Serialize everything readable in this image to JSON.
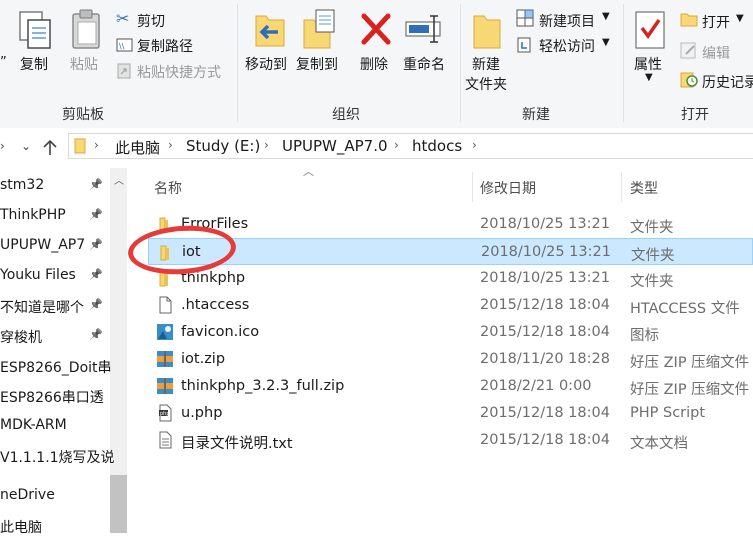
{
  "ribbon": {
    "clipboard": {
      "copy_stub": "”",
      "copy": "复制",
      "paste": "粘贴",
      "cut": "剪切",
      "copy_path": "复制路径",
      "paste_shortcut": "粘贴快捷方式",
      "group": "剪贴板"
    },
    "organize": {
      "move_to": "移动到",
      "copy_to": "复制到",
      "delete": "删除",
      "rename": "重命名",
      "group": "组织"
    },
    "new": {
      "new_folder_line1": "新建",
      "new_folder_line2": "文件夹",
      "new_item": "新建项目",
      "easy_access": "轻松访问",
      "group": "新建"
    },
    "open": {
      "properties": "属性",
      "open": "打开",
      "edit": "编辑",
      "history": "历史记录",
      "group": "打开"
    }
  },
  "breadcrumb": [
    "此电脑",
    "Study (E:)",
    "UPUPW_AP7.0",
    "htdocs"
  ],
  "sidebar": {
    "items": [
      {
        "label": "stm32",
        "pinned": true
      },
      {
        "label": "ThinkPHP",
        "pinned": true
      },
      {
        "label": "UPUPW_AP7",
        "pinned": true
      },
      {
        "label": "Youku Files",
        "pinned": true
      },
      {
        "label": "不知道是哪个",
        "pinned": true
      },
      {
        "label": "穿梭机",
        "pinned": true
      },
      {
        "label": "ESP8266_Doit串",
        "pinned": false
      },
      {
        "label": "ESP8266串口透",
        "pinned": false
      },
      {
        "label": "MDK-ARM",
        "pinned": false
      },
      {
        "label": "V1.1.1.1烧写及说",
        "pinned": false
      },
      {
        "label": "neDrive",
        "pinned": false
      },
      {
        "label": "此电脑",
        "pinned": false
      }
    ]
  },
  "columns": {
    "name": "名称",
    "modified": "修改日期",
    "type": "类型"
  },
  "files": [
    {
      "name": "ErrorFiles",
      "date": "2018/10/25 13:21",
      "type": "文件夹",
      "icon": "folder-icon",
      "selected": false
    },
    {
      "name": "iot",
      "date": "2018/10/25 13:21",
      "type": "文件夹",
      "icon": "folder-icon",
      "selected": true
    },
    {
      "name": "thinkphp",
      "date": "2018/10/25 13:21",
      "type": "文件夹",
      "icon": "folder-icon",
      "selected": false
    },
    {
      "name": ".htaccess",
      "date": "2015/12/18 18:04",
      "type": "HTACCESS 文件",
      "icon": "blank-file-icon",
      "selected": false
    },
    {
      "name": "favicon.ico",
      "date": "2015/12/18 18:04",
      "type": "图标",
      "icon": "image-file-icon",
      "selected": false
    },
    {
      "name": "iot.zip",
      "date": "2018/11/20 18:28",
      "type": "好压 ZIP 压缩文件",
      "icon": "archive-icon",
      "selected": false
    },
    {
      "name": "thinkphp_3.2.3_full.zip",
      "date": "2018/2/21 0:00",
      "type": "好压 ZIP 压缩文件",
      "icon": "archive-icon",
      "selected": false
    },
    {
      "name": "u.php",
      "date": "2015/12/18 18:04",
      "type": "PHP Script",
      "icon": "php-file-icon",
      "selected": false
    },
    {
      "name": "目录文件说明.txt",
      "date": "2015/12/18 18:04",
      "type": "文本文档",
      "icon": "text-file-icon",
      "selected": false
    }
  ],
  "colors": {
    "selection": "#cce8ff",
    "annotation": "#e63b3b",
    "folder": "#f8d775",
    "delete": "#d7221f"
  }
}
